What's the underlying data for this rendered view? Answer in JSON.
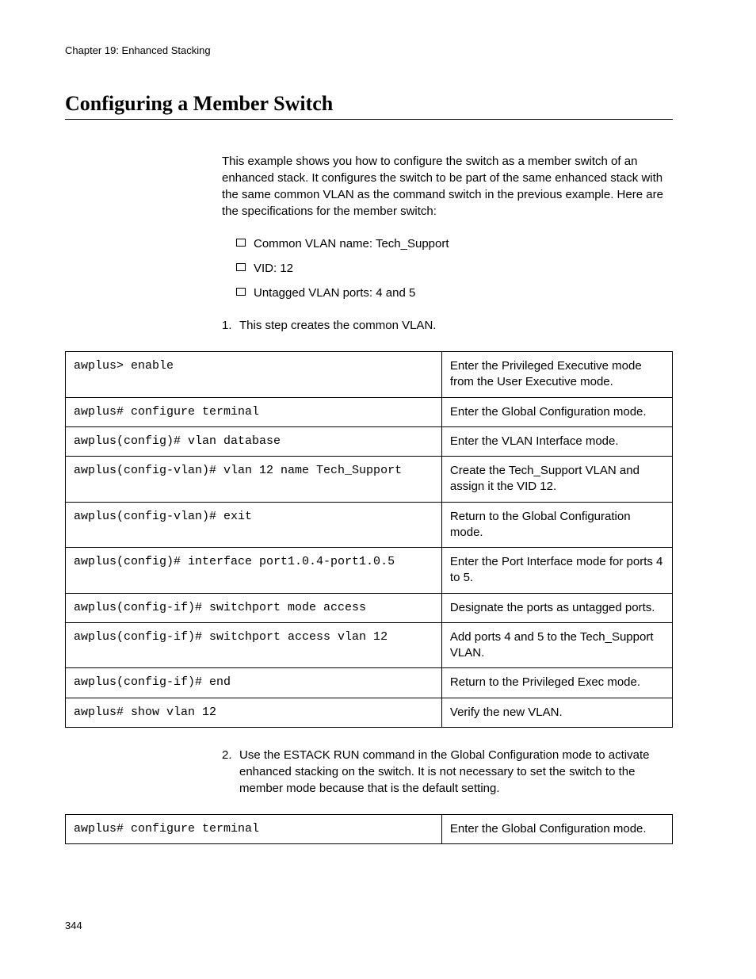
{
  "chapter_header": "Chapter 19: Enhanced Stacking",
  "section_title": "Configuring a Member Switch",
  "intro": "This example shows you how to configure the switch as a member switch of an enhanced stack. It configures the switch to be part of the same enhanced stack with the same common VLAN as the command switch in the previous example. Here are the specifications for the member switch:",
  "bullets": {
    "b0": "Common VLAN name: Tech_Support",
    "b1": "VID: 12",
    "b2": "Untagged VLAN ports: 4 and 5"
  },
  "steps": {
    "s1_num": "1.",
    "s1_text": "This step creates the common VLAN.",
    "s2_num": "2.",
    "s2_text": "Use the ESTACK RUN command in the Global Configuration mode to activate enhanced stacking on the switch. It is not necessary to set the switch to the member mode because that is the default setting."
  },
  "table1": {
    "r0": {
      "cmd": "awplus> enable",
      "desc": "Enter the Privileged Executive mode from the User Executive mode."
    },
    "r1": {
      "cmd": "awplus# configure terminal",
      "desc": "Enter the Global Configuration mode."
    },
    "r2": {
      "cmd": "awplus(config)# vlan database",
      "desc": "Enter the VLAN Interface mode."
    },
    "r3": {
      "cmd": "awplus(config-vlan)# vlan 12 name Tech_Support",
      "desc": "Create the Tech_Support VLAN and assign it the VID 12."
    },
    "r4": {
      "cmd": "awplus(config-vlan)# exit",
      "desc": "Return to the Global Configuration mode."
    },
    "r5": {
      "cmd": "awplus(config)# interface port1.0.4-port1.0.5",
      "desc": "Enter the Port Interface mode for ports 4 to 5."
    },
    "r6": {
      "cmd": "awplus(config-if)# switchport mode access",
      "desc": "Designate the ports as untagged ports."
    },
    "r7": {
      "cmd": "awplus(config-if)# switchport access vlan 12",
      "desc": "Add ports 4 and 5 to the Tech_Support VLAN."
    },
    "r8": {
      "cmd": "awplus(config-if)# end",
      "desc": "Return to the Privileged Exec mode."
    },
    "r9": {
      "cmd": "awplus# show vlan 12",
      "desc": "Verify the new VLAN."
    }
  },
  "table2": {
    "r0": {
      "cmd": "awplus# configure terminal",
      "desc": "Enter the Global Configuration mode."
    }
  },
  "page_number": "344"
}
